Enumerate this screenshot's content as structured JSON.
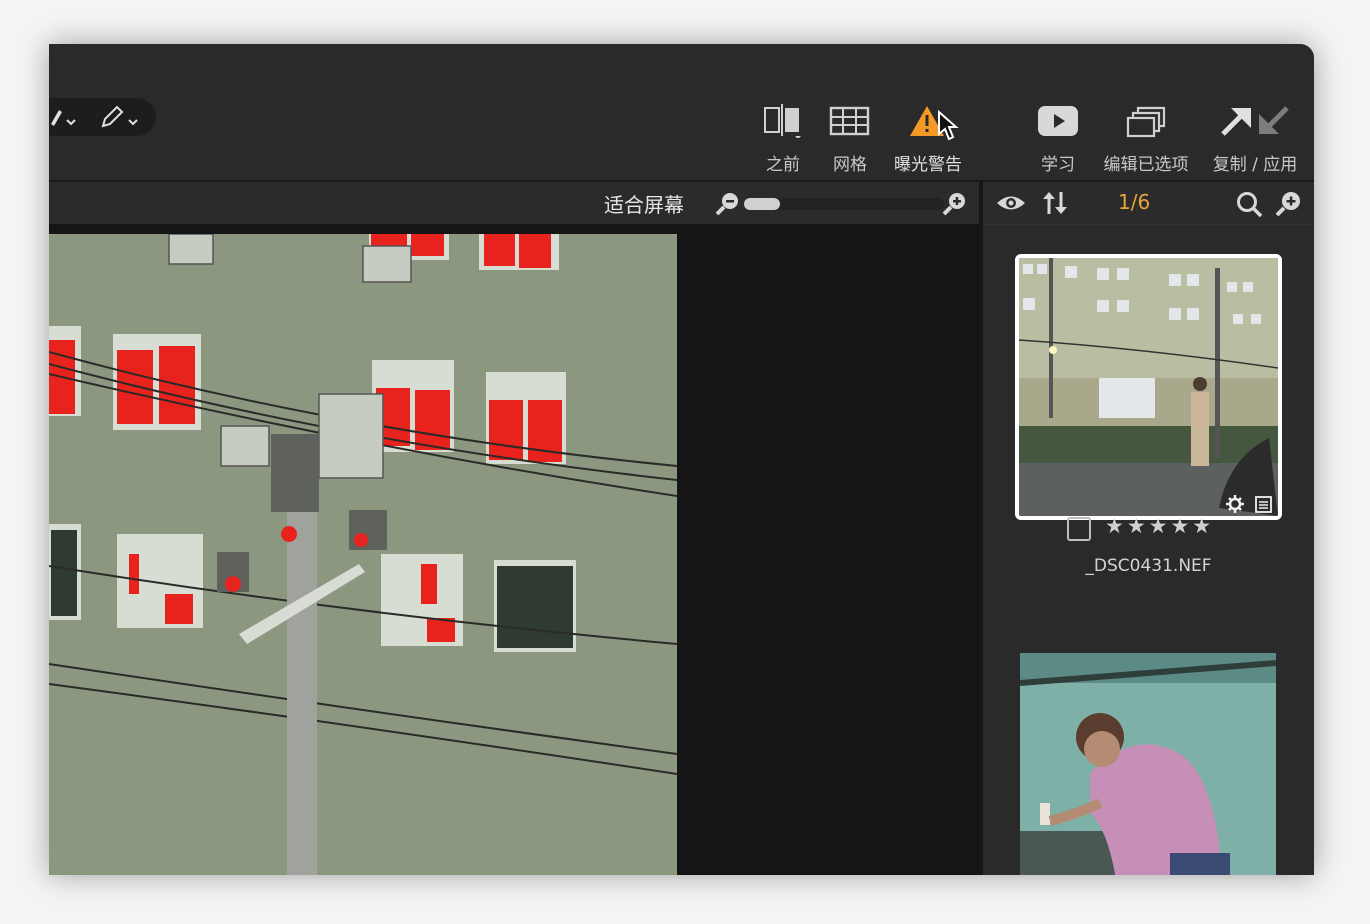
{
  "toolbar": {
    "before_label": "之前",
    "grid_label": "网格",
    "exposure_label": "曝光警告",
    "learn_label": "学习",
    "edit_sel_label": "编辑已选项",
    "copy_label": "复制 / 应用"
  },
  "viewbar": {
    "fit_label": "适合屏幕",
    "zoom_fraction": 0.18
  },
  "filmstrip": {
    "counter": "1/6",
    "items": [
      {
        "filename": "_DSC0431.NEF",
        "stars": "★★★★★",
        "selected": true
      },
      {
        "filename": "",
        "stars": "",
        "selected": false
      }
    ]
  },
  "colors": {
    "accent": "#e8a33d",
    "warning_icon": "#f39a26",
    "highlight_clip": "#e8231d"
  },
  "icons": [
    "pencil-icon",
    "eraser-icon",
    "before-icon",
    "grid-icon",
    "warning-icon",
    "cursor-icon",
    "play-icon",
    "stack-icon",
    "arrow-up-right-icon",
    "arrow-down-left-icon",
    "zoom-out-icon",
    "zoom-in-icon",
    "eye-icon",
    "sort-icon",
    "search-icon",
    "gear-icon",
    "sidecar-icon"
  ]
}
